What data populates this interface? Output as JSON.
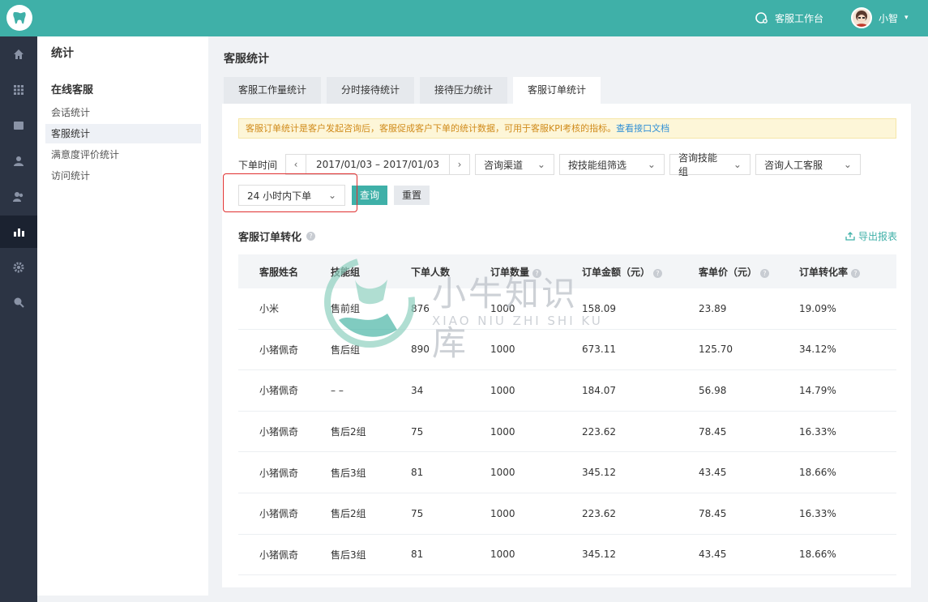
{
  "topbar": {
    "workspace_label": "客服工作台",
    "user_name": "小智"
  },
  "sidenav": {
    "title": "统计",
    "group": "在线客服",
    "items": [
      {
        "label": "会话统计"
      },
      {
        "label": "客服统计"
      },
      {
        "label": "满意度评价统计"
      },
      {
        "label": "访问统计"
      }
    ]
  },
  "main": {
    "page_title": "客服统计",
    "tabs": [
      {
        "label": "客服工作量统计"
      },
      {
        "label": "分时接待统计"
      },
      {
        "label": "接待压力统计"
      },
      {
        "label": "客服订单统计"
      }
    ],
    "notice": {
      "text": "客服订单统计是客户发起咨询后，客服促成客户下单的统计数据，可用于客服KPI考核的指标。",
      "link": "查看接口文档"
    },
    "filters": {
      "order_time_label": "下单时间",
      "date_range": "2017/01/03 – 2017/01/03",
      "channel": "咨询渠道",
      "skill_filter": "按技能组筛选",
      "skill_group": "咨询技能组",
      "agent": "咨询人工客服",
      "window": "24 小时内下单",
      "query_btn": "查询",
      "reset_btn": "重置"
    },
    "section_title": "客服订单转化",
    "export_label": "导出报表",
    "table": {
      "headers": [
        "客服姓名",
        "技能组",
        "下单人数",
        "订单数量",
        "订单金额（元）",
        "客单价（元）",
        "订单转化率"
      ],
      "rows": [
        [
          "小米",
          "售前组",
          "876",
          "1000",
          "158.09",
          "23.89",
          "19.09%"
        ],
        [
          "小猪佩奇",
          "售后组",
          "890",
          "1000",
          "673.11",
          "125.70",
          "34.12%"
        ],
        [
          "小猪佩奇",
          "– –",
          "34",
          "1000",
          "184.07",
          "56.98",
          "14.79%"
        ],
        [
          "小猪佩奇",
          "售后2组",
          "75",
          "1000",
          "223.62",
          "78.45",
          "16.33%"
        ],
        [
          "小猪佩奇",
          "售后3组",
          "81",
          "1000",
          "345.12",
          "43.45",
          "18.66%"
        ],
        [
          "小猪佩奇",
          "售后2组",
          "75",
          "1000",
          "223.62",
          "78.45",
          "16.33%"
        ],
        [
          "小猪佩奇",
          "售后3组",
          "81",
          "1000",
          "345.12",
          "43.45",
          "18.66%"
        ]
      ]
    }
  },
  "watermark": {
    "cn": "小牛知识库",
    "en": "XIAO NIU ZHI SHI KU"
  }
}
